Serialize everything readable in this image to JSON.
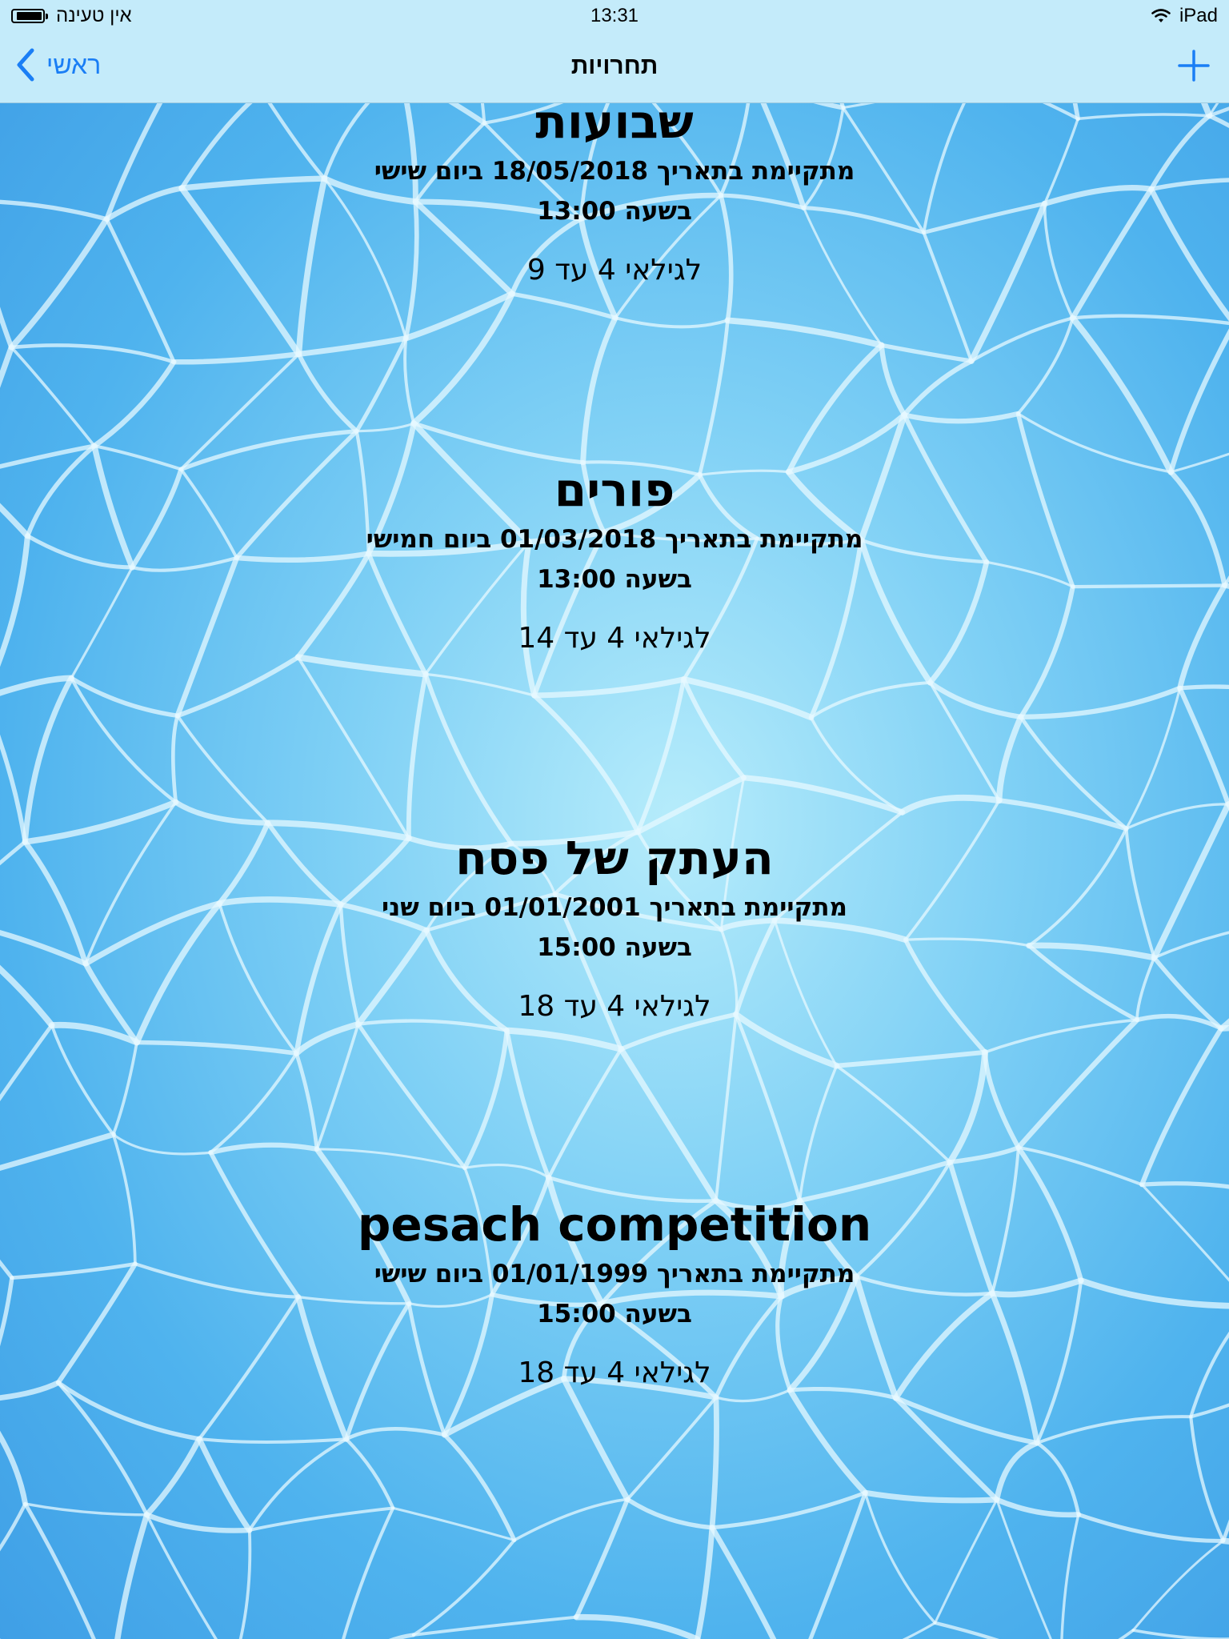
{
  "status_bar": {
    "carrier": "אין טעינה",
    "time": "13:31",
    "device": "iPad",
    "battery_level": 0.9
  },
  "nav": {
    "title": "תחרויות",
    "back_label": "ראשי",
    "back_icon": "chevron-left-icon",
    "add_icon": "plus-icon",
    "accent_color": "#1a7ef5"
  },
  "competitions": [
    {
      "name": "שבועות",
      "date_line": "מתקיימת בתאריך 18/05/2018 ביום שישי",
      "time_line": "בשעה 13:00",
      "ages_line": "לגילאי 4 עד 9"
    },
    {
      "name": "פורים",
      "date_line": "מתקיימת בתאריך 01/03/2018 ביום חמישי",
      "time_line": "בשעה 13:00",
      "ages_line": "לגילאי 4 עד 14"
    },
    {
      "name": "העתק של פסח",
      "date_line": "מתקיימת בתאריך 01/01/2001 ביום שני",
      "time_line": "בשעה 15:00",
      "ages_line": "לגילאי 4 עד 18"
    },
    {
      "name": "pesach competition",
      "date_line": "מתקיימת בתאריך 01/01/1999 ביום שישי",
      "time_line": "בשעה 15:00",
      "ages_line": "לגילאי 4 עד 18"
    }
  ]
}
